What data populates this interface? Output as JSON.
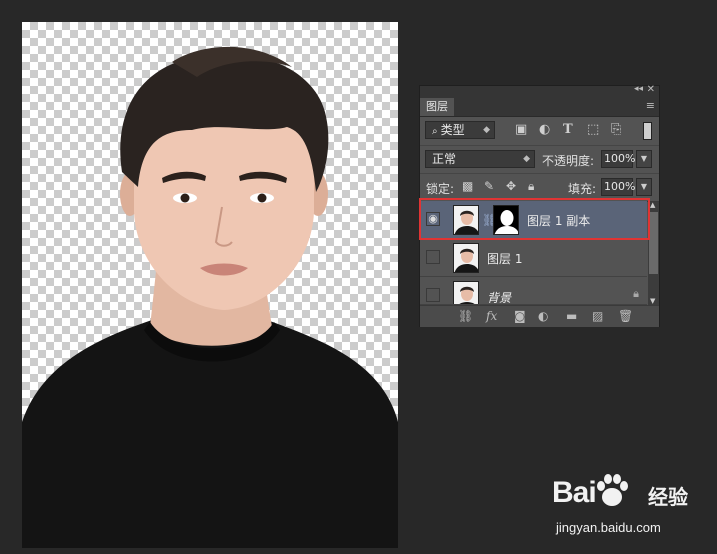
{
  "canvas": {
    "subject": "portrait-cutout"
  },
  "layers_panel": {
    "tab_label": "图层",
    "collapse_icon": "◂◂",
    "close_icon": "✕",
    "menu_icon": "≡",
    "filter": {
      "kind_label": "类型",
      "icons": [
        "image-filter-icon",
        "adjustment-filter-icon",
        "text-filter-icon",
        "shape-filter-icon",
        "smart-object-filter-icon"
      ]
    },
    "blend_mode": "正常",
    "opacity_label": "不透明度:",
    "opacity_value": "100%",
    "lock_label": "锁定:",
    "fill_label": "填充:",
    "fill_value": "100%",
    "layers": [
      {
        "name": "图层 1 副本",
        "visible": true,
        "selected": true,
        "has_mask": true
      },
      {
        "name": "图层 1",
        "visible": false,
        "selected": false,
        "has_mask": false
      },
      {
        "name": "背景",
        "visible": false,
        "selected": false,
        "has_mask": false,
        "locked": true
      }
    ]
  },
  "watermark": {
    "logo_text": "Bai",
    "logo_suffix": "经验",
    "url": "jingyan.baidu.com"
  },
  "colors": {
    "highlight": "#e03434",
    "selected_layer": "#5a6478",
    "panel_bg": "#535353",
    "app_bg": "#282828"
  }
}
